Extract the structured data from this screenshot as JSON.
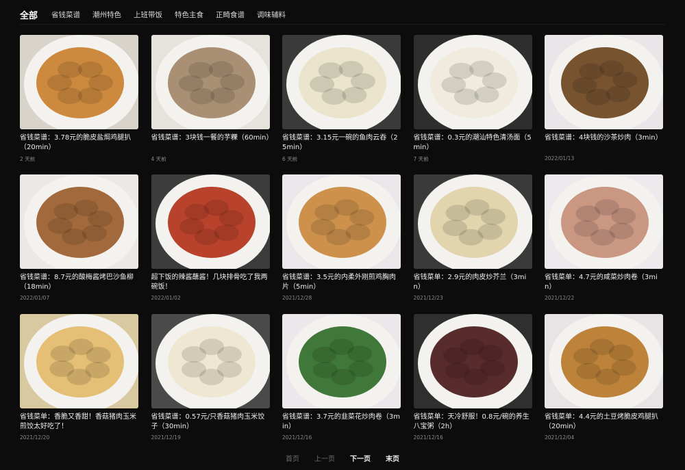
{
  "tabs": [
    {
      "label": "全部",
      "active": true
    },
    {
      "label": "省钱菜谱",
      "active": false
    },
    {
      "label": "潮州特色",
      "active": false
    },
    {
      "label": "上班带饭",
      "active": false
    },
    {
      "label": "特色主食",
      "active": false
    },
    {
      "label": "正畸食谱",
      "active": false
    },
    {
      "label": "调味辅料",
      "active": false
    }
  ],
  "cards": [
    {
      "title": "省钱菜谱：3.78元的脆皮盐焗鸡腿扒（20min）",
      "date": "2 天前",
      "image": "chicken-leg-steak-photo",
      "bg": "#d8d4cc",
      "food": "#c9812f"
    },
    {
      "title": "省钱菜谱：3块钱一餐的芋粿（60min）",
      "date": "4 天前",
      "image": "taro-cake-photo",
      "bg": "#e6e3dd",
      "food": "#a2886a"
    },
    {
      "title": "省钱菜谱：3.15元一碗的鱼肉云吞（25min）",
      "date": "6 天前",
      "image": "fish-wonton-bowl-photo",
      "bg": "#3a3a3a",
      "food": "#e7e3c8"
    },
    {
      "title": "省钱菜谱：0.3元的潮汕特色清汤面（5min）",
      "date": "7 天前",
      "image": "noodle-soup-bowl-photo",
      "bg": "#2e2e2e",
      "food": "#efeadb"
    },
    {
      "title": "省钱菜谱：4块钱的沙茶炒肉（3min）",
      "date": "2022/01/13",
      "image": "shacha-stir-fry-pork-photo",
      "bg": "#e9e5e8",
      "food": "#6b4520"
    },
    {
      "title": "省钱菜谱：8.7元的酸梅酱烤巴沙鱼柳（18min）",
      "date": "2022/01/07",
      "image": "grilled-basa-fillet-photo",
      "bg": "#ece8e6",
      "food": "#9a5e2c"
    },
    {
      "title": "超下饭的辣酱蘸酱！几块排骨吃了我两碗饭！",
      "date": "2022/01/02",
      "image": "spicy-dipping-sauce-photo",
      "bg": "#3c3c3c",
      "food": "#b3331b"
    },
    {
      "title": "省钱菜谱：3.5元的内柔外刚煎鸡胸肉片（5min）",
      "date": "2021/12/28",
      "image": "pan-fried-chicken-breast-photo",
      "bg": "#ebe6ea",
      "food": "#c9893e"
    },
    {
      "title": "省钱菜单：2.9元的肉皮炒芥兰（3min）",
      "date": "2021/12/23",
      "image": "pork-skin-kailan-photo",
      "bg": "#3a3a3a",
      "food": "#e0d2a8"
    },
    {
      "title": "省钱菜单：4.7元的咸菜炒肉卷（3min）",
      "date": "2021/12/22",
      "image": "pickled-veg-meat-roll-photo",
      "bg": "#ede9ec",
      "food": "#c58f7a"
    },
    {
      "title": "省钱菜单：香脆又香甜！香菇猪肉玉米煎饺太好吃了！",
      "date": "2021/12/20",
      "image": "pan-fried-dumplings-photo",
      "bg": "#d9c9a0",
      "food": "#e2bb6a"
    },
    {
      "title": "省钱菜谱：0.57元/只香菇猪肉玉米饺子（30min）",
      "date": "2021/12/19",
      "image": "corn-pork-dumpling-photo",
      "bg": "#4a4a4a",
      "food": "#efe6cf"
    },
    {
      "title": "省钱菜谱：3.7元的韭菜花炒肉卷（3min）",
      "date": "2021/12/16",
      "image": "chive-flower-meat-roll-photo",
      "bg": "#ebe7ea",
      "food": "#2f6e28"
    },
    {
      "title": "省钱菜单：天冷舒服！0.8元/碗的养生八宝粥（2h）",
      "date": "2021/12/16",
      "image": "eight-treasure-porridge-photo",
      "bg": "#2f2f2f",
      "food": "#4a1a1c"
    },
    {
      "title": "省钱菜单：4.4元的土豆烤脆皮鸡腿扒（20min）",
      "date": "2021/12/04",
      "image": "potato-roast-chicken-photo",
      "bg": "#e8e4e6",
      "food": "#b87a2a"
    }
  ],
  "pagination": {
    "first": "首页",
    "prev": "上一页",
    "next": "下一页",
    "last": "末页"
  }
}
